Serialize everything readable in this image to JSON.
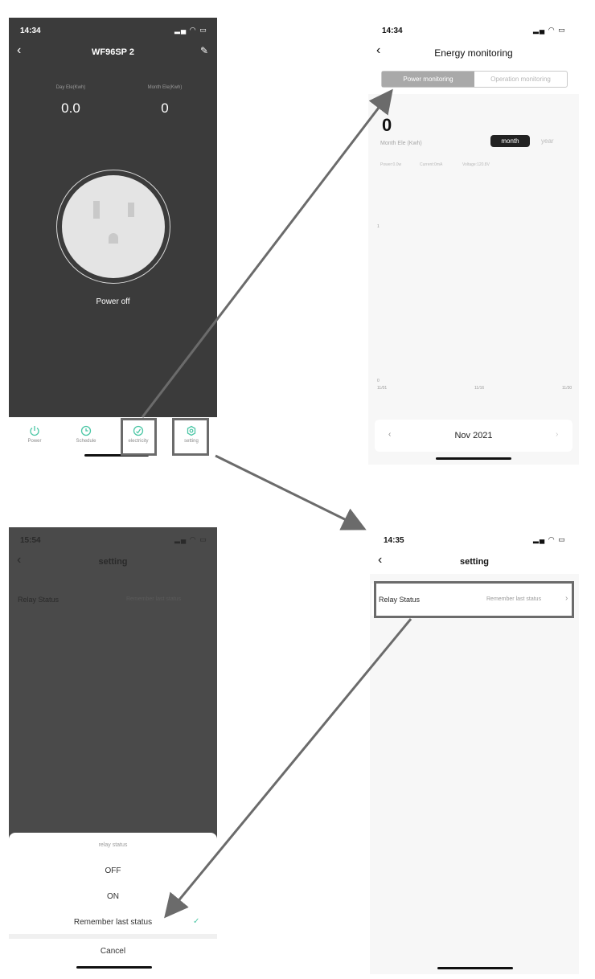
{
  "phone_main": {
    "status_time": "14:34",
    "device_name": "WF96SP 2",
    "day_ele_label": "Day Ele(Kwh)",
    "day_ele_value": "0.0",
    "month_ele_label": "Month Ele(Kwh)",
    "month_ele_value": "0",
    "power_state": "Power off",
    "nav": [
      {
        "label": "Power",
        "icon": "power-icon"
      },
      {
        "label": "Schedule",
        "icon": "clock-icon"
      },
      {
        "label": "electricity",
        "icon": "gauge-icon"
      },
      {
        "label": "setting",
        "icon": "gear-icon"
      }
    ]
  },
  "phone_energy": {
    "status_time": "14:34",
    "title": "Energy monitoring",
    "tab_power": "Power monitoring",
    "tab_operation": "Operation monitoring",
    "big_value": "0",
    "value_caption": "Month Ele (Kwh)",
    "toggle_month": "month",
    "toggle_year": "year",
    "stats_power": "Power:0.0w",
    "stats_current": "Current:0mA",
    "stats_voltage": "Voltage:120.8V",
    "y_tick_1": "1",
    "y_tick_0": "0",
    "x_tick_1": "11/01",
    "x_tick_2": "11/16",
    "x_tick_3": "11/30",
    "period": "Nov 2021"
  },
  "phone_setting_dark": {
    "status_time": "15:54",
    "title": "setting",
    "relay_label": "Relay Status",
    "relay_value": "Remember last status",
    "sheet_title": "relay status",
    "option_off": "OFF",
    "option_on": "ON",
    "option_remember": "Remember last status",
    "cancel": "Cancel"
  },
  "phone_setting": {
    "status_time": "14:35",
    "title": "setting",
    "relay_label": "Relay Status",
    "relay_value": "Remember last status"
  },
  "colors": {
    "dark_bg": "#3b3b3b",
    "accent_green": "#4cc7a6",
    "arrow_gray": "#6b6b6b"
  }
}
